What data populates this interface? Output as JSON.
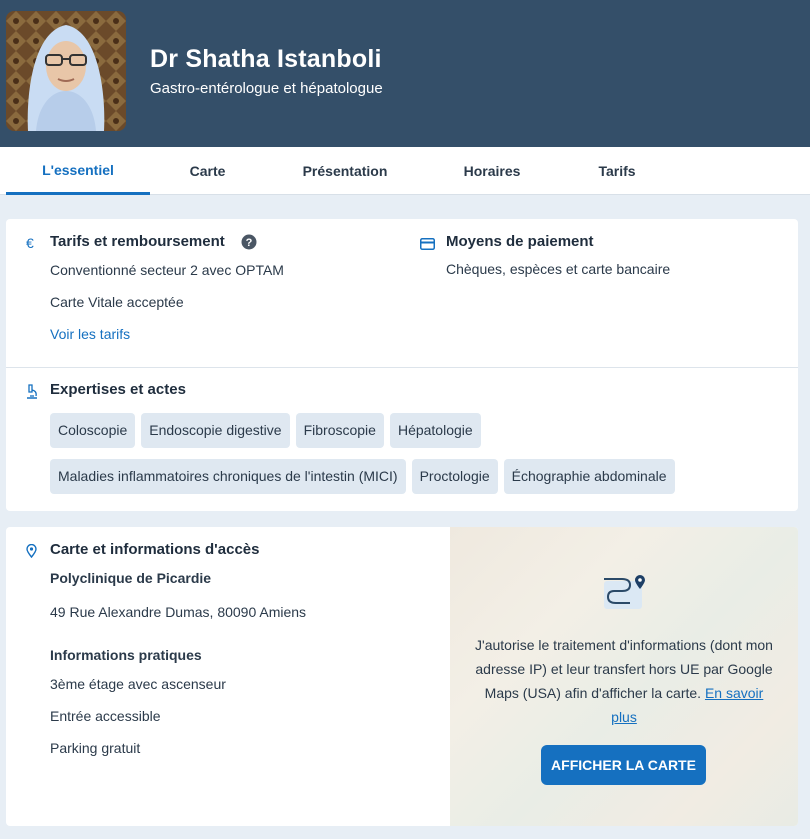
{
  "header": {
    "name": "Dr Shatha Istanboli",
    "specialty": "Gastro-entérologue et hépatologue"
  },
  "tabs": [
    {
      "label": "L'essentiel",
      "active": true
    },
    {
      "label": "Carte"
    },
    {
      "label": "Présentation"
    },
    {
      "label": "Horaires"
    },
    {
      "label": "Tarifs"
    }
  ],
  "fees": {
    "title": "Tarifs et remboursement",
    "help_icon": "question-circle-icon",
    "convention": "Conventionné secteur 2 avec OPTAM",
    "vitale": "Carte Vitale acceptée",
    "link": "Voir les tarifs"
  },
  "payment": {
    "title": "Moyens de paiement",
    "methods": "Chèques, espèces et carte bancaire"
  },
  "expertise": {
    "title": "Expertises et actes",
    "items": [
      "Coloscopie",
      "Endoscopie digestive",
      "Fibroscopie",
      "Hépatologie",
      "Maladies inflammatoires chroniques de l'intestin (MICI)",
      "Proctologie",
      "Échographie abdominale"
    ]
  },
  "access": {
    "title": "Carte et informations d'accès",
    "place": "Polyclinique de Picardie",
    "address": "49 Rue Alexandre Dumas, 80090 Amiens",
    "practical_title": "Informations pratiques",
    "practical": [
      "3ème étage avec ascenseur",
      "Entrée accessible",
      "Parking gratuit"
    ]
  },
  "map": {
    "consent_text": "J'autorise le traitement d'informations (dont mon adresse IP) et leur transfert hors UE par Google Maps (USA) afin d'afficher la carte. ",
    "learn_more": "En savoir plus",
    "button": "AFFICHER LA CARTE"
  },
  "colors": {
    "header_bg": "#344f69",
    "accent": "#1570c0",
    "chip_bg": "#dfe8f1"
  }
}
